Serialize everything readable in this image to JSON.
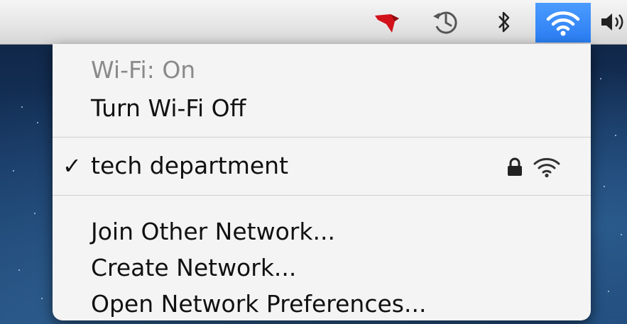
{
  "menubar": {
    "icons": [
      "cardinal-app-icon",
      "time-machine-icon",
      "bluetooth-icon",
      "wifi-icon",
      "volume-icon"
    ],
    "active_color": "#2a7df2"
  },
  "wifi_menu": {
    "status": "Wi-Fi: On",
    "toggle_label": "Turn Wi-Fi Off",
    "networks": [
      {
        "name": "tech department",
        "connected": true,
        "checkmark": "✓",
        "secured": true,
        "signal": "full"
      }
    ],
    "actions": {
      "join": "Join Other Network...",
      "create": "Create Network...",
      "preferences": "Open Network Preferences..."
    }
  }
}
